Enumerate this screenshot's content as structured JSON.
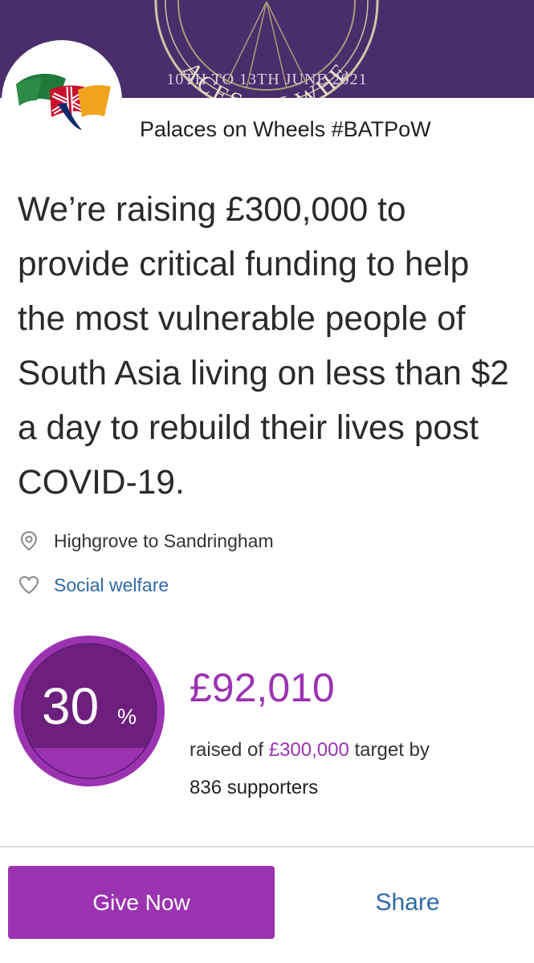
{
  "banner": {
    "arc_text": "ACES ON WHE",
    "date_text": "10TH TO 13TH JUNE 2021"
  },
  "campaign": {
    "name": "Palaces on Wheels #BATPoW",
    "headline": "We’re raising £300,000 to provide critical funding to help the most vulnerable people of South Asia living on less than $2 a day to rebuild their lives post COVID-19."
  },
  "details": {
    "location": "Highgrove to Sandringham",
    "cause": "Social welfare"
  },
  "progress": {
    "percent": "30",
    "percent_sign": "%",
    "fraction": 0.3,
    "raised": "£92,010",
    "raised_prefix": "raised of",
    "target": "£300,000",
    "target_suffix": "target by",
    "supporters": "836 supporters"
  },
  "actions": {
    "give_label": "Give Now",
    "share_label": "Share"
  },
  "colors": {
    "banner": "#4a2d6b",
    "accent": "#9b33b1",
    "link": "#2f6aa6"
  },
  "icons": {
    "location": "map-pin-icon",
    "cause": "heart-icon"
  }
}
